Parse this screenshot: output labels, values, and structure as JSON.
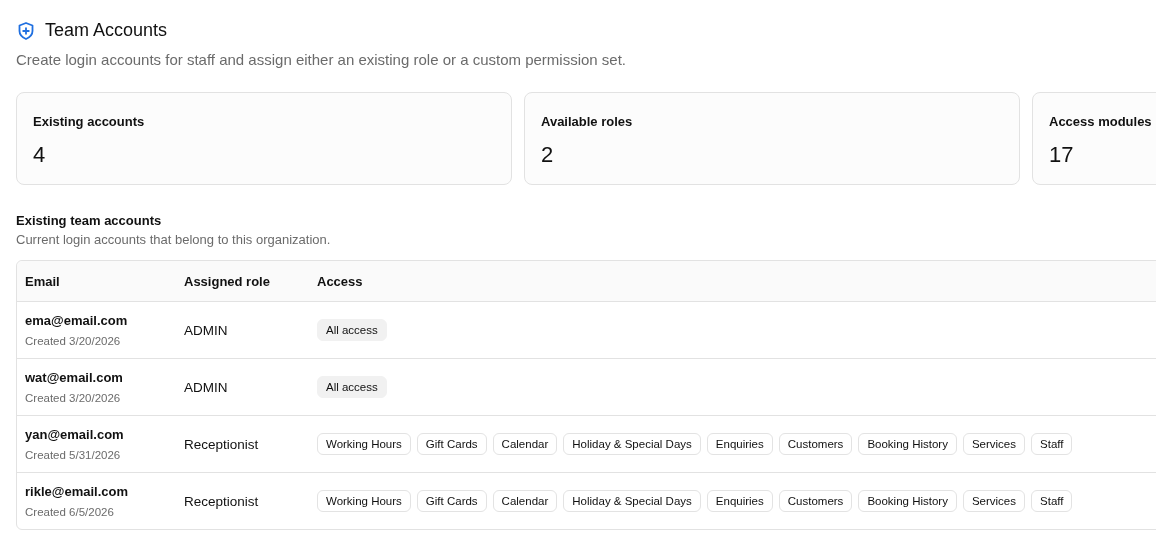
{
  "header": {
    "title": "Team Accounts",
    "subtitle": "Create login accounts for staff and assign either an existing role or a custom permission set."
  },
  "stats": [
    {
      "label": "Existing accounts",
      "value": "4"
    },
    {
      "label": "Available roles",
      "value": "2"
    },
    {
      "label": "Access modules",
      "value": "17"
    }
  ],
  "section": {
    "title": "Existing team accounts",
    "subtitle": "Current login accounts that belong to this organization."
  },
  "table": {
    "columns": [
      "Email",
      "Assigned role",
      "Access"
    ],
    "rows": [
      {
        "email": "ema@email.com",
        "created": "Created 3/20/2026",
        "role": "ADMIN",
        "access": [
          {
            "label": "All access",
            "kind": "all"
          }
        ]
      },
      {
        "email": "wat@email.com",
        "created": "Created 3/20/2026",
        "role": "ADMIN",
        "access": [
          {
            "label": "All access",
            "kind": "all"
          }
        ]
      },
      {
        "email": "yan@email.com",
        "created": "Created 5/31/2026",
        "role": "Receptionist",
        "access": [
          {
            "label": "Working Hours",
            "kind": "module"
          },
          {
            "label": "Gift Cards",
            "kind": "module"
          },
          {
            "label": "Calendar",
            "kind": "module"
          },
          {
            "label": "Holiday & Special Days",
            "kind": "module"
          },
          {
            "label": "Enquiries",
            "kind": "module"
          },
          {
            "label": "Customers",
            "kind": "module"
          },
          {
            "label": "Booking History",
            "kind": "module"
          },
          {
            "label": "Services",
            "kind": "module"
          },
          {
            "label": "Staff",
            "kind": "module"
          }
        ]
      },
      {
        "email": "rikle@email.com",
        "created": "Created 6/5/2026",
        "role": "Receptionist",
        "access": [
          {
            "label": "Working Hours",
            "kind": "module"
          },
          {
            "label": "Gift Cards",
            "kind": "module"
          },
          {
            "label": "Calendar",
            "kind": "module"
          },
          {
            "label": "Holiday & Special Days",
            "kind": "module"
          },
          {
            "label": "Enquiries",
            "kind": "module"
          },
          {
            "label": "Customers",
            "kind": "module"
          },
          {
            "label": "Booking History",
            "kind": "module"
          },
          {
            "label": "Services",
            "kind": "module"
          },
          {
            "label": "Staff",
            "kind": "module"
          }
        ]
      }
    ]
  }
}
